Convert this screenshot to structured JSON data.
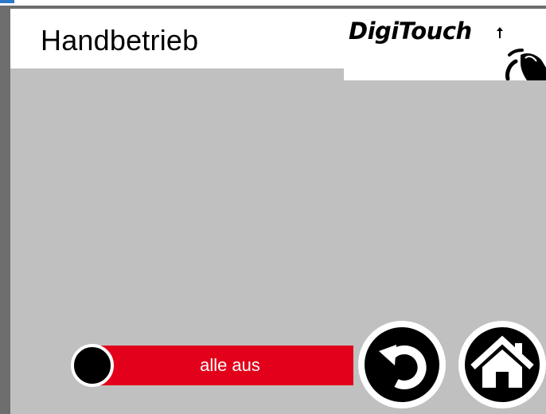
{
  "header": {
    "title": "Handbetrieb",
    "logo_text": "DigiTouch"
  },
  "controls": {
    "all_off_label": "alle aus",
    "toggle_color": "#e2001a"
  },
  "nav": {
    "back_icon": "back-arrow-icon",
    "home_icon": "home-icon"
  }
}
